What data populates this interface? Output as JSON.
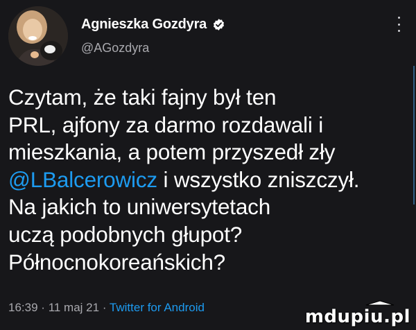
{
  "author": {
    "display_name": "Agnieszka Gozdyra",
    "handle": "@AGozdyra"
  },
  "tweet": {
    "lines": [
      "Czytam, że taki fajny był ten",
      "PRL, ajfony za darmo rozdawali i",
      "mieszkania, a potem przyszedł zły",
      "Na jakich to uniwersytetach",
      "uczą podobnych głupot?",
      "Północnokoreańskich?"
    ],
    "mention": "@LBalcerowicz",
    "mention_suffix": " i wszystko zniszczył.",
    "time": "16:39",
    "date": "11 maj 21",
    "separator": "·",
    "client": "Twitter for Android"
  },
  "watermark": "mdupiu.pl",
  "colors": {
    "background": "#17171a",
    "accent": "#1d9bf0",
    "secondary_text": "#a9a9ae"
  },
  "icons": {
    "verified": "verified-badge-icon",
    "more": "more-vertical-icon"
  }
}
